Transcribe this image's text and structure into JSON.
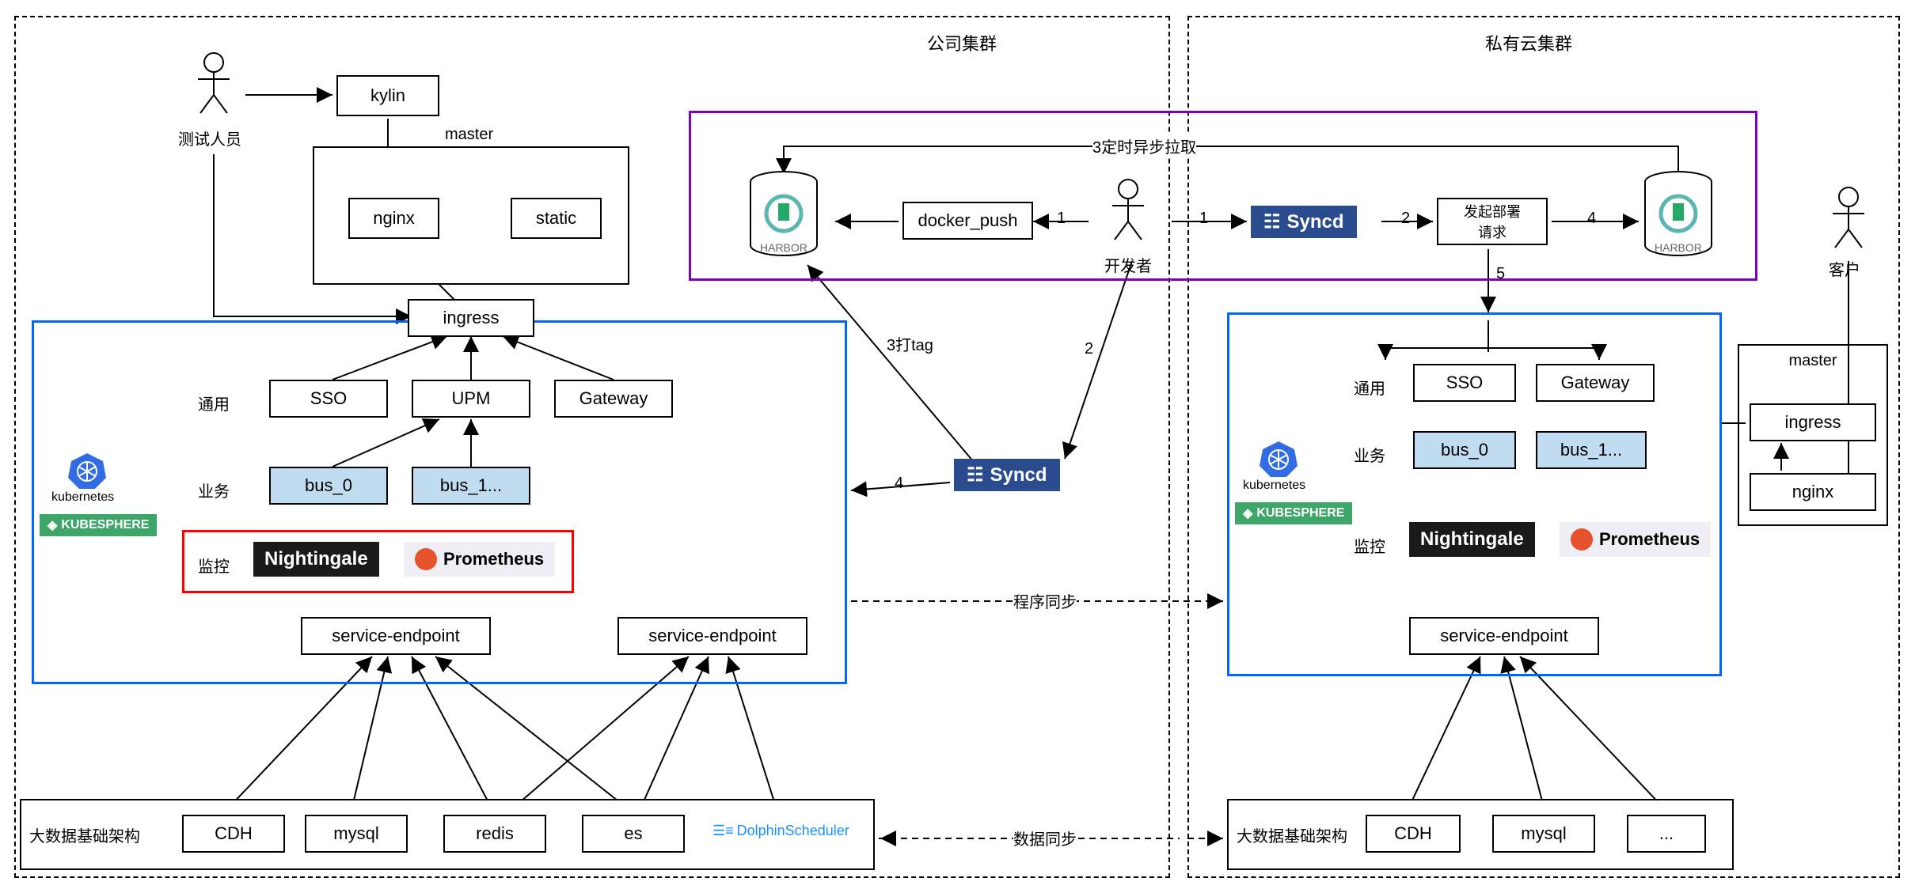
{
  "clusters": {
    "company": "公司集群",
    "private": "私有云集群"
  },
  "actors": {
    "tester": "测试人员",
    "developer": "开发者",
    "customer": "客户"
  },
  "left": {
    "kylin": "kylin",
    "master": "master",
    "nginx": "nginx",
    "static": "static",
    "ingress": "ingress",
    "general": "通用",
    "sso": "SSO",
    "upm": "UPM",
    "gateway": "Gateway",
    "business": "业务",
    "bus0": "bus_0",
    "bus1": "bus_1...",
    "monitor": "监控",
    "nightingale": "Nightingale",
    "prometheus": "Prometheus",
    "kubernetes": "kubernetes",
    "kubesphere": "KUBESPHERE",
    "se1": "service-endpoint",
    "se2": "service-endpoint",
    "bigdata": "大数据基础架构",
    "cdh": "CDH",
    "mysql": "mysql",
    "redis": "redis",
    "es": "es",
    "dolphin": "DolphinScheduler"
  },
  "right": {
    "master": "master",
    "ingress": "ingress",
    "nginx": "nginx",
    "general": "通用",
    "sso": "SSO",
    "gateway": "Gateway",
    "business": "业务",
    "bus0": "bus_0",
    "bus1": "bus_1...",
    "monitor": "监控",
    "nightingale": "Nightingale",
    "prometheus": "Prometheus",
    "kubernetes": "kubernetes",
    "kubesphere": "KUBESPHERE",
    "se": "service-endpoint",
    "bigdata": "大数据基础架构",
    "cdh": "CDH",
    "mysql": "mysql",
    "more": "..."
  },
  "center": {
    "docker_push": "docker_push",
    "syncd_top": "Syncd",
    "syncd_mid": "Syncd",
    "deploy_req1": "发起部署",
    "deploy_req2": "请求",
    "harbor": "HARBOR",
    "tag": "3打tag",
    "pull": "3定时异步拉取",
    "prog_sync": "程序同步",
    "data_sync": "数据同步"
  },
  "edge_nums": {
    "n1a": "1",
    "n1b": "1",
    "n2a": "2",
    "n2b": "2",
    "n4a": "4",
    "n4b": "4",
    "n5": "5"
  }
}
